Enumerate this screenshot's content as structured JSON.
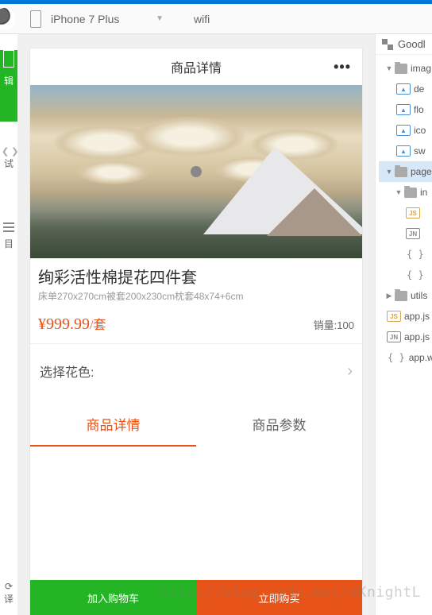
{
  "topbar": {
    "device": "iPhone 7 Plus",
    "network": "wifi",
    "project": "Goodl"
  },
  "tree": {
    "images": {
      "label": "imag",
      "items": [
        "de",
        "flo",
        "ico",
        "sw"
      ]
    },
    "pages": {
      "label": "page",
      "index": {
        "label": "in",
        "files_badge": [
          "JS",
          "JN"
        ]
      }
    },
    "utils": "utils",
    "root": {
      "js": "app.js",
      "json": "app.js",
      "wxss": "app.w"
    }
  },
  "left": {
    "edit": "辑",
    "debug": "试",
    "project": "目",
    "translate": "译"
  },
  "page": {
    "header": "商品详情",
    "title": "绚彩活性棉提花四件套",
    "subtitle": "床单270x270cm被套200x230cm枕套48x74+6cm",
    "price": "¥999.99",
    "price_unit": "/套",
    "sales_label": "销量:",
    "sales_value": "100",
    "option_label": "选择花色:",
    "tab_detail": "商品详情",
    "tab_param": "商品参数",
    "btn_cart": "加入购物车",
    "btn_buy": "立即购买"
  },
  "watermark": "http://blog.csdn.net/dKnightL"
}
